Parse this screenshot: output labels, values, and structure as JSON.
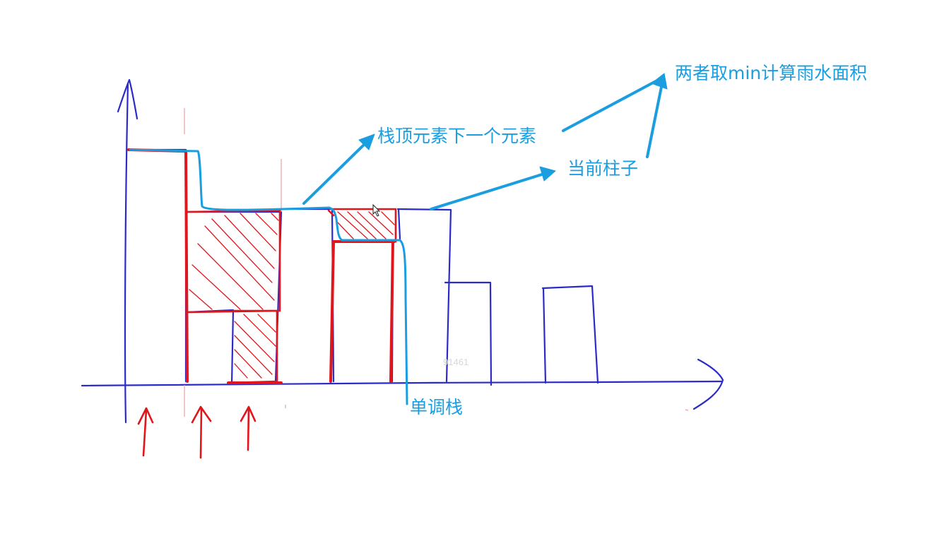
{
  "annotations": {
    "stack_top_next": "栈顶元素下一个元素",
    "current_pillar": "当前柱子",
    "min_area": "两者取min计算雨水面积",
    "monotonic_stack": "单调栈"
  },
  "watermark": "91461",
  "colors": {
    "bars": "#2b2bc8",
    "water": "#e0161c",
    "stack_path": "#1a9ee0",
    "background": "#ffffff"
  },
  "icons": {
    "mouse_cursor": "cursor-arrow-icon"
  }
}
